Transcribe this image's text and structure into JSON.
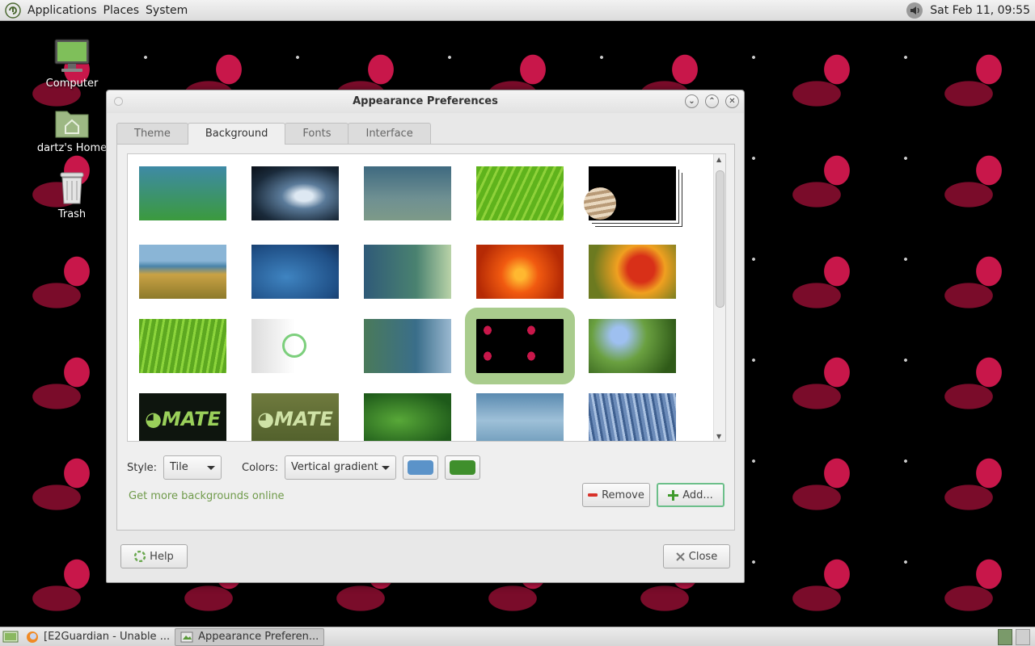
{
  "top_panel": {
    "menus": [
      "Applications",
      "Places",
      "System"
    ],
    "clock": "Sat Feb 11, 09:55"
  },
  "desktop": {
    "icons": [
      {
        "label": "Computer",
        "icon": "computer-icon"
      },
      {
        "label": "dartz's Home",
        "icon": "home-folder-icon"
      },
      {
        "label": "Trash",
        "icon": "trash-icon"
      }
    ]
  },
  "window": {
    "title": "Appearance Preferences",
    "tabs": [
      "Theme",
      "Background",
      "Fonts",
      "Interface"
    ],
    "active_tab": "Background",
    "background": {
      "style_label": "Style:",
      "style_value": "Tile",
      "colors_label": "Colors:",
      "colors_value": "Vertical gradient",
      "primary_color": "#5b93c9",
      "secondary_color": "#3f8f2c",
      "more_link": "Get more backgrounds online",
      "remove_label": "Remove",
      "add_label": "Add...",
      "selected_index": 13,
      "thumbnails": [
        "blue-green gradient",
        "water drop",
        "blue-grey gradient",
        "green leaf",
        "jupiter",
        "beach grass",
        "blue bubbles",
        "blue sparkle",
        "orange flower",
        "red flower",
        "grass",
        "mate logo white",
        "green-blue waves",
        "dark pattern",
        "blue flowers",
        "mate logo dark",
        "mate logo green",
        "green leaves",
        "blue waves",
        "blue plants"
      ]
    },
    "help_label": "Help",
    "close_label": "Close"
  },
  "taskbar": {
    "tasks": [
      "[E2Guardian - Unable ...",
      "Appearance Preferen..."
    ]
  },
  "colors": {
    "selection": "#a9cc8d",
    "link": "#6f9a4a"
  }
}
